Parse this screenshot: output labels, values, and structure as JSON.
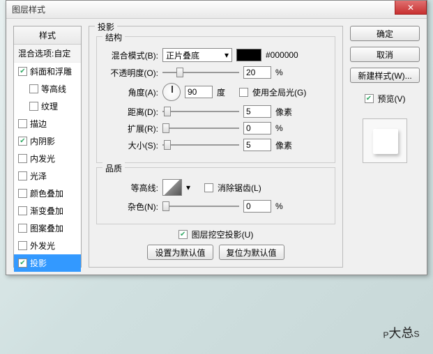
{
  "title": "图层样式",
  "sidebar": {
    "header": "样式",
    "sub": "混合选项:自定",
    "items": [
      {
        "label": "斜面和浮雕",
        "checked": true,
        "indent": false
      },
      {
        "label": "等高线",
        "checked": false,
        "indent": true
      },
      {
        "label": "纹理",
        "checked": false,
        "indent": true
      },
      {
        "label": "描边",
        "checked": false,
        "indent": false
      },
      {
        "label": "内阴影",
        "checked": true,
        "indent": false
      },
      {
        "label": "内发光",
        "checked": false,
        "indent": false
      },
      {
        "label": "光泽",
        "checked": false,
        "indent": false
      },
      {
        "label": "颜色叠加",
        "checked": false,
        "indent": false
      },
      {
        "label": "渐变叠加",
        "checked": false,
        "indent": false
      },
      {
        "label": "图案叠加",
        "checked": false,
        "indent": false
      },
      {
        "label": "外发光",
        "checked": false,
        "indent": false
      },
      {
        "label": "投影",
        "checked": true,
        "indent": false,
        "selected": true
      }
    ]
  },
  "panel": {
    "title": "投影",
    "struct_legend": "结构",
    "blend_label": "混合模式(B):",
    "blend_value": "正片叠底",
    "color_hex": "#000000",
    "opacity_label": "不透明度(O):",
    "opacity_value": "20",
    "opacity_unit": "%",
    "angle_label": "角度(A):",
    "angle_value": "90",
    "angle_unit": "度",
    "global_light": "使用全局光(G)",
    "distance_label": "距离(D):",
    "distance_value": "5",
    "distance_unit": "像素",
    "spread_label": "扩展(R):",
    "spread_value": "0",
    "spread_unit": "%",
    "size_label": "大小(S):",
    "size_value": "5",
    "size_unit": "像素",
    "quality_legend": "品质",
    "contour_label": "等高线:",
    "antialias": "消除锯齿(L)",
    "noise_label": "杂色(N):",
    "noise_value": "0",
    "noise_unit": "%",
    "knockout": "图层挖空投影(U)",
    "btn_default": "设置为默认值",
    "btn_reset": "复位为默认值"
  },
  "right": {
    "ok": "确定",
    "cancel": "取消",
    "new_style": "新建样式(W)...",
    "preview": "预览(V)"
  },
  "watermark": {
    "big": "P",
    "mid": "大总",
    "end": "S"
  }
}
